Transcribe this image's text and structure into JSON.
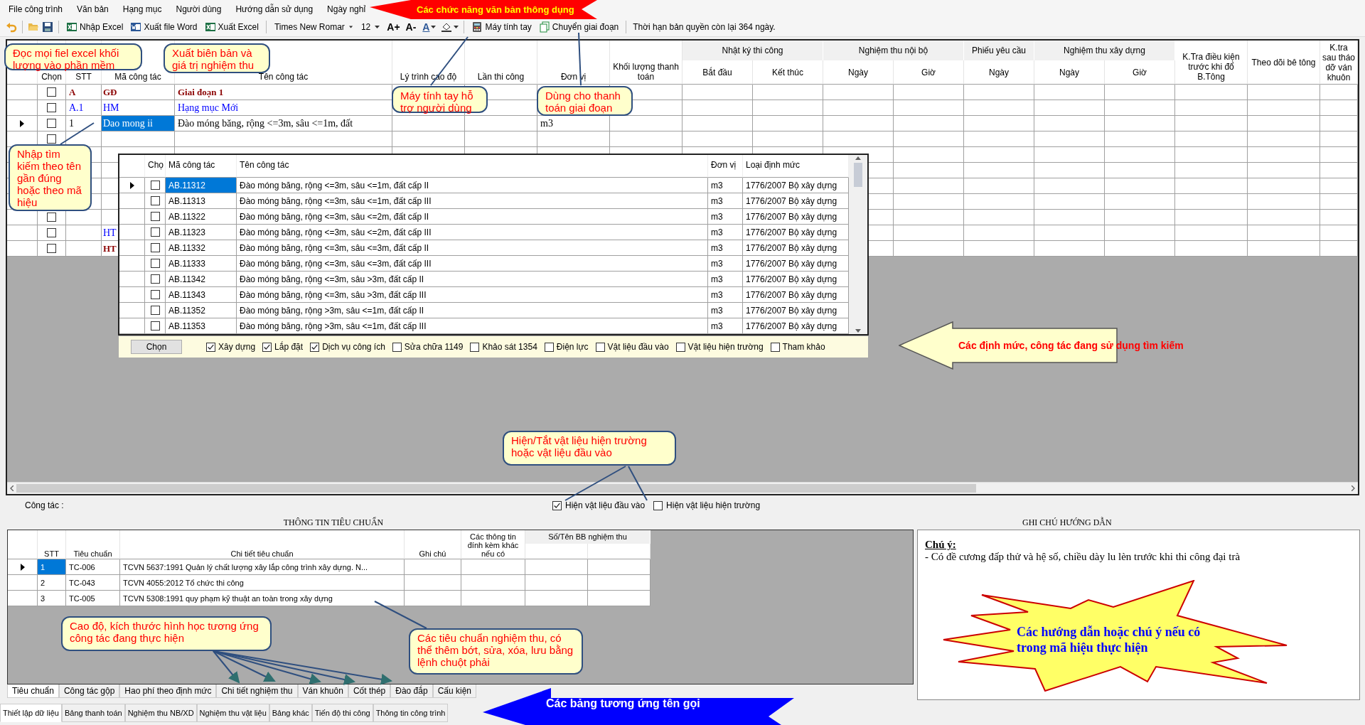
{
  "menu": [
    "File công trình",
    "Văn bản",
    "Hạng mục",
    "Người dùng",
    "Hướng dẫn sử dụng",
    "Ngày nghỉ"
  ],
  "toolbar": {
    "buttons": [
      {
        "kind": "excel",
        "label": "Nhập Excel"
      },
      {
        "kind": "word",
        "label": "Xuất file Word"
      },
      {
        "kind": "excel",
        "label": "Xuất Excel"
      }
    ],
    "font_name": "Times New Romar",
    "font_size": "12",
    "grow_font": "A+",
    "shrink_font": "A-",
    "font_color": "A",
    "tools": [
      {
        "kind": "calculator",
        "label": "Máy tính tay"
      },
      {
        "kind": "copy",
        "label": "Chuyển giai đoạn"
      }
    ],
    "license": "Thời hạn bản quyền còn lại 364 ngày."
  },
  "main_grid": {
    "columns": [
      {
        "label": "Chọn"
      },
      {
        "label": "STT"
      },
      {
        "label": "Mã công tác"
      },
      {
        "label": "Tên công tác"
      },
      {
        "label": "Lý trình cao độ"
      },
      {
        "label": "Lần thi công"
      },
      {
        "label": "Đơn vị"
      },
      {
        "label": "Khối lượng thanh toán"
      },
      {
        "label": "Nhật ký thi công",
        "subcolumns": [
          {
            "label": "Bắt đầu"
          },
          {
            "label": "Kết thúc"
          }
        ]
      },
      {
        "label": "Nghiệm thu nội bộ",
        "subcolumns": [
          {
            "label": "Ngày"
          },
          {
            "label": "Giờ"
          }
        ]
      },
      {
        "label": "Phiếu yêu cầu",
        "subcolumns": [
          {
            "label": "Ngày"
          }
        ]
      },
      {
        "label": "Nghiệm thu xây dựng",
        "subcolumns": [
          {
            "label": "Ngày"
          },
          {
            "label": "Giờ"
          }
        ]
      },
      {
        "label": "K.Tra điều kiện trước khi đổ B.Tông"
      },
      {
        "label": "Theo dõi bê tông"
      },
      {
        "label": "K.tra sau tháo dỡ ván khuôn"
      }
    ],
    "rows": [
      {
        "kind": "phase",
        "selected": false,
        "checked": false,
        "stt": "A",
        "code": "GĐ",
        "name": "Giai đoạn 1"
      },
      {
        "kind": "category",
        "selected": false,
        "checked": false,
        "stt": "A.1",
        "code": "HM",
        "name": "Hạng mục Mới"
      },
      {
        "kind": "work",
        "selected": true,
        "checked": false,
        "stt": "1",
        "code": "Dao mong ii",
        "name": "Đào móng băng, rộng <=3m, sâu <=1m, đất",
        "unit": "m3"
      },
      {
        "kind": "blank",
        "selected": false,
        "checked": false
      },
      {
        "kind": "blank",
        "selected": false
      },
      {
        "kind": "blank",
        "selected": false
      },
      {
        "kind": "blank",
        "selected": false
      },
      {
        "kind": "blank",
        "selected": false
      },
      {
        "kind": "blank",
        "selected": false,
        "checked": false
      },
      {
        "kind": "category",
        "selected": false,
        "checked": false,
        "code": "HT"
      },
      {
        "kind": "phase",
        "selected": false,
        "checked": false,
        "code": "HT"
      }
    ]
  },
  "search_popup": {
    "columns": [
      "Chọ",
      "Mã công tác",
      "Tên công tác",
      "Đơn vị",
      "Loại định mức"
    ],
    "rows": [
      {
        "selected": true,
        "checked": false,
        "code": "AB.11312",
        "name": "Đào móng băng, rộng <=3m, sâu <=1m, đất cấp II",
        "unit": "m3",
        "norm": "1776/2007 Bộ xây dựng"
      },
      {
        "selected": false,
        "checked": false,
        "code": "AB.11313",
        "name": "Đào móng băng, rộng <=3m, sâu <=1m, đất cấp III",
        "unit": "m3",
        "norm": "1776/2007 Bộ xây dựng"
      },
      {
        "selected": false,
        "checked": false,
        "code": "AB.11322",
        "name": "Đào móng băng, rộng <=3m, sâu <=2m, đất cấp II",
        "unit": "m3",
        "norm": "1776/2007 Bộ xây dựng"
      },
      {
        "selected": false,
        "checked": false,
        "code": "AB.11323",
        "name": "Đào móng băng, rộng <=3m, sâu <=2m, đất cấp III",
        "unit": "m3",
        "norm": "1776/2007 Bộ xây dựng"
      },
      {
        "selected": false,
        "checked": false,
        "code": "AB.11332",
        "name": "Đào móng băng, rộng <=3m, sâu <=3m, đất cấp II",
        "unit": "m3",
        "norm": "1776/2007 Bộ xây dựng"
      },
      {
        "selected": false,
        "checked": false,
        "code": "AB.11333",
        "name": "Đào móng băng, rộng <=3m, sâu <=3m, đất cấp III",
        "unit": "m3",
        "norm": "1776/2007 Bộ xây dựng"
      },
      {
        "selected": false,
        "checked": false,
        "code": "AB.11342",
        "name": "Đào móng băng, rộng <=3m, sâu >3m, đất cấp II",
        "unit": "m3",
        "norm": "1776/2007 Bộ xây dựng"
      },
      {
        "selected": false,
        "checked": false,
        "code": "AB.11343",
        "name": "Đào móng băng, rộng <=3m, sâu >3m, đất cấp III",
        "unit": "m3",
        "norm": "1776/2007 Bộ xây dựng"
      },
      {
        "selected": false,
        "checked": false,
        "code": "AB.11352",
        "name": "Đào móng băng, rộng >3m, sâu <=1m, đất cấp II",
        "unit": "m3",
        "norm": "1776/2007 Bộ xây dựng"
      },
      {
        "selected": false,
        "checked": false,
        "code": "AB.11353",
        "name": "Đào móng băng, rộng >3m, sâu <=1m, đất cấp III",
        "unit": "m3",
        "norm": "1776/2007 Bộ xây dựng"
      }
    ],
    "button": "Chọn",
    "filters": [
      {
        "label": "Xây dựng",
        "checked": true
      },
      {
        "label": "Lắp đặt",
        "checked": true
      },
      {
        "label": "Dịch vụ công ích",
        "checked": true
      },
      {
        "label": "Sửa chữa 1149",
        "checked": false
      },
      {
        "label": "Khảo sát 1354",
        "checked": false
      },
      {
        "label": "Điện lực",
        "checked": false
      },
      {
        "label": "Vật liệu đầu vào",
        "checked": false
      },
      {
        "label": "Vật liệu hiện trường",
        "checked": false
      },
      {
        "label": "Tham khảo",
        "checked": false
      }
    ]
  },
  "work_label": "Công tác :",
  "toggles": [
    {
      "label": "Hiện vật liệu đầu vào",
      "checked": true
    },
    {
      "label": "Hiện vật liệu hiện trường",
      "checked": false
    }
  ],
  "standards": {
    "title": "THÔNG TIN TIÊU CHUẨN",
    "columns": [
      "STT",
      "Tiêu chuẩn",
      "Chi tiết tiêu chuẩn",
      "Ghi chú",
      "Các thông tin đính kèm khác nếu có"
    ],
    "group_header": "Số/Tên BB nghiệm thu",
    "rows": [
      {
        "selected": true,
        "stt": "1",
        "standard": "TC-006",
        "detail": "TCVN 5637:1991 Quản lý chất lượng xây lắp công trình xây dựng. N..."
      },
      {
        "selected": false,
        "stt": "2",
        "standard": "TC-043",
        "detail": "TCVN 4055:2012 Tổ chức thi công"
      },
      {
        "selected": false,
        "stt": "3",
        "standard": "TC-005",
        "detail": "TCVN 5308:1991 quy phạm kỹ thuật an toàn trong xây dựng"
      }
    ]
  },
  "sub_tabs": [
    {
      "label": "Tiêu chuẩn",
      "selected": true
    },
    {
      "label": "Công tác gộp",
      "selected": false
    },
    {
      "label": "Hao phí theo định mức",
      "selected": false
    },
    {
      "label": "Chi tiết nghiệm thu",
      "selected": false
    },
    {
      "label": "Ván khuôn",
      "selected": false
    },
    {
      "label": "Cốt thép",
      "selected": false
    },
    {
      "label": "Đào đắp",
      "selected": false
    },
    {
      "label": "Cấu kiện",
      "selected": false
    }
  ],
  "notes": {
    "title": "GHI CHÚ HƯỚNG DẪN",
    "heading": "Chú ý:",
    "text": "- Có đề cương đấp thử và hệ số, chiều dày lu lèn trước khi thi công đại trà"
  },
  "bottom_tabs": [
    {
      "label": "Thiết lập dữ liệu",
      "selected": true
    },
    {
      "label": "Bảng thanh toán",
      "selected": false
    },
    {
      "label": "Nghiệm thu NB/XD",
      "selected": false
    },
    {
      "label": "Nghiệm thu vật liệu",
      "selected": false
    },
    {
      "label": "Bảng khác",
      "selected": false
    },
    {
      "label": "Tiến độ thi công",
      "selected": false
    },
    {
      "label": "Thông tin công trình",
      "selected": false
    }
  ],
  "callouts": [
    {
      "text": "Đọc mọi fiel excel khối lượng vào phần mềm"
    },
    {
      "text": "Xuất biên bản và giá trị nghiệm thu"
    },
    {
      "text": "Máy tính tay hỗ trợ người dùng"
    },
    {
      "text": "Dùng cho thanh toán giai đoạn"
    },
    {
      "text": "Nhập tìm kiếm theo tên gần đúng hoặc theo mã hiệu"
    },
    {
      "text": "Hiện/Tắt vật liệu hiện trường hoặc vật liệu đầu vào"
    },
    {
      "text": "Cao độ, kích thước hình học tương ứng công tác đang thực hiện"
    },
    {
      "text": "Các tiêu chuẩn nghiệm thu, có thể  thêm bớt, sửa, xóa, lưu bằng lệnh chuột phải"
    }
  ],
  "arrows": [
    {
      "kind": "red",
      "text": "Các chức năng văn bản thông dụng"
    },
    {
      "kind": "yellow",
      "text": "Các định mức, công tác đang sử dụng tìm kiếm"
    },
    {
      "kind": "blue",
      "text": "Các bảng tương ứng tên gọi"
    }
  ],
  "starburst": {
    "text": "Các hướng dẫn hoặc chú ý nếu có trong mã hiệu thực hiện"
  }
}
